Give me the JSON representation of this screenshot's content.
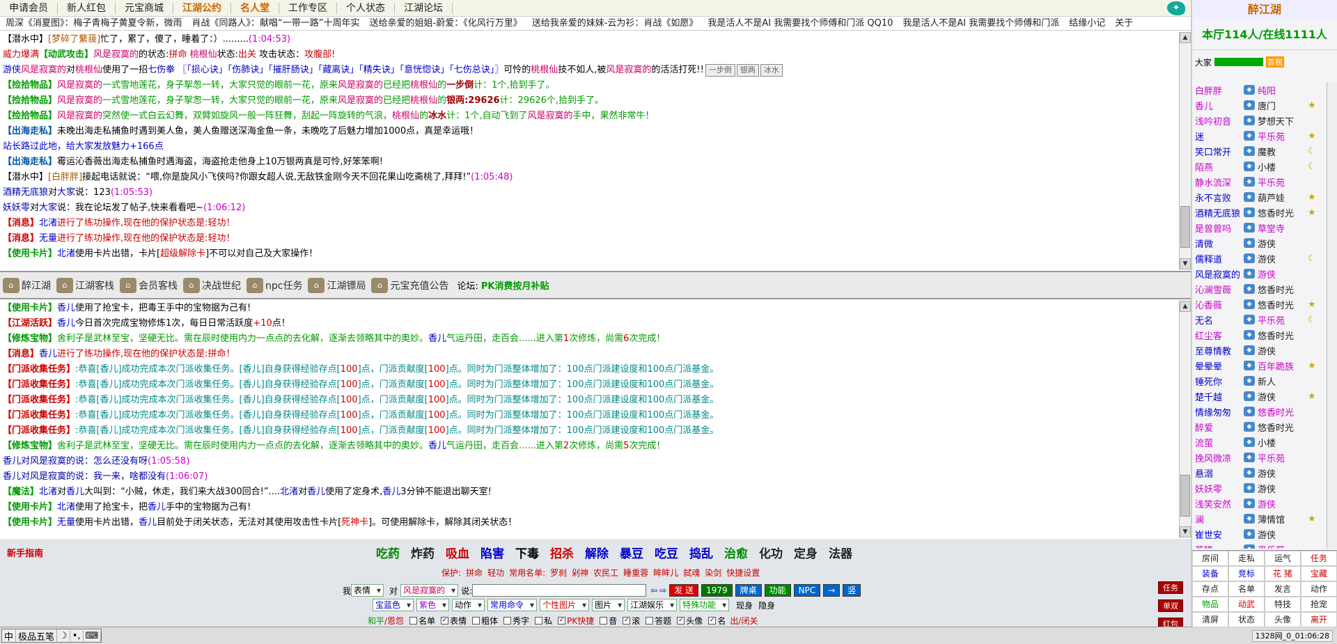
{
  "nav": [
    "申请会员",
    "新人红包",
    "元宝商城",
    "江湖公约",
    "名人堂",
    "工作专区",
    "个人状态",
    "江湖论坛"
  ],
  "marquee": [
    "周深《消夏图》：梅子青梅子黄夏令新，微雨",
    "肖战《同路人》：献唱“一带一路”十周年实",
    "送给亲爱的姐姐-蔚爱：《化风行万里》",
    "送给我亲爱的妹妹-云为衫：肖战《如愿》",
    "我是活人不是AI 我需要找个师傅和门派 QQ10",
    "我是活人不是AI 我需要找个师傅和门派",
    "结缘小记",
    "关于"
  ],
  "chat_top": [
    [
      {
        "t": "【潜水中】",
        "c": "g"
      },
      {
        "t": "[梦碎了蘩菝]",
        "c": "brn"
      },
      {
        "t": "忙了，累了，傻了，睡着了：）.........",
        "c": ""
      },
      {
        "t": "(1:04:53)",
        "c": "mag"
      }
    ],
    [
      {
        "t": "威力爆满",
        "c": "red"
      },
      {
        "t": "【动武攻击】",
        "c": "gtag"
      },
      {
        "t": "风是寂寞的",
        "c": "pink"
      },
      {
        "t": "的状态:",
        "c": ""
      },
      {
        "t": "拼命",
        "c": "red"
      },
      {
        "t": " 桃根仙",
        "c": "pink"
      },
      {
        "t": "状态:",
        "c": ""
      },
      {
        "t": "出关",
        "c": "red"
      },
      {
        "t": " 攻击状态：",
        "c": ""
      },
      {
        "t": "攻腹部!",
        "c": "red"
      }
    ],
    [
      {
        "t": "游侠",
        "c": "blue"
      },
      {
        "t": "风是寂寞的",
        "c": "pink"
      },
      {
        "t": "对",
        "c": ""
      },
      {
        "t": "桃根仙",
        "c": "pink"
      },
      {
        "t": "使用了一招",
        "c": ""
      },
      {
        "t": "七伤拳",
        "c": "nm"
      },
      {
        "t": " 〖「损心诀」「伤肺诀」「摧肝肠诀」「藏离诀」「精失诀」「意恍惚诀」「七伤总诀」〗",
        "c": "blue"
      },
      {
        "t": "可怜的",
        "c": ""
      },
      {
        "t": "桃根仙",
        "c": "pink"
      },
      {
        "t": "技不如人,被",
        "c": ""
      },
      {
        "t": "风是寂寞的",
        "c": "pink"
      },
      {
        "t": "的活活打死!!",
        "c": ""
      }
    ],
    [
      {
        "t": "【捡拾物品】",
        "c": "gtag"
      },
      {
        "t": "风是寂寞的",
        "c": "pink"
      },
      {
        "t": "一式雪地莲花，身子挐怱一转，大家只觉的眼前一花，原来",
        "c": "green"
      },
      {
        "t": "风是寂寞的",
        "c": "pink"
      },
      {
        "t": "已经把",
        "c": "green"
      },
      {
        "t": "桃根仙",
        "c": "pink"
      },
      {
        "t": "的",
        "c": "green"
      },
      {
        "t": "一步倒",
        "c": "dred"
      },
      {
        "t": "计：1个,拾到手了。",
        "c": "green"
      }
    ],
    [
      {
        "t": "【捡拾物品】",
        "c": "gtag"
      },
      {
        "t": "风是寂寞的",
        "c": "pink"
      },
      {
        "t": "一式雪地莲花，身子挐怱一转，大家只觉的眼前一花，原来",
        "c": "green"
      },
      {
        "t": "风是寂寞的",
        "c": "pink"
      },
      {
        "t": "已经把",
        "c": "green"
      },
      {
        "t": "桃根仙",
        "c": "pink"
      },
      {
        "t": "的",
        "c": "green"
      },
      {
        "t": "银两:29626",
        "c": "dred"
      },
      {
        "t": "计：29626个,拾到手了。",
        "c": "green"
      }
    ],
    [
      {
        "t": "【捡拾物品】",
        "c": "gtag"
      },
      {
        "t": "风是寂寞的",
        "c": "pink"
      },
      {
        "t": "突然使一式白云幻舞，双臂如旋风一般一阵狂舞，刮起一阵旋转的气浪，",
        "c": "green"
      },
      {
        "t": "桃根仙",
        "c": "pink"
      },
      {
        "t": "的",
        "c": "green"
      },
      {
        "t": "冰水",
        "c": "dred"
      },
      {
        "t": "计：1个,自动飞到了",
        "c": "green"
      },
      {
        "t": "风是寂寞的",
        "c": "pink"
      },
      {
        "t": "手中，果然非常牛！",
        "c": "green"
      }
    ],
    [
      {
        "t": "【出海走私】",
        "c": "btag"
      },
      {
        "t": "未晚出海走私捕鱼时遇到美人鱼，美人鱼赠送深海金鱼一条，未晚吃了后魅力增加1000点，真是幸运哦！",
        "c": ""
      }
    ],
    [
      {
        "t": "站长路过此地，给大家发放魅力+166点",
        "c": "blue"
      }
    ],
    [
      {
        "t": "【出海走私】",
        "c": "btag"
      },
      {
        "t": "霉运沁香薇出海走私捕鱼时遇海盗，海盗抢走他身上10万银两真是可怜,好笨笨啊!",
        "c": ""
      }
    ],
    [
      {
        "t": "【潜水中】",
        "c": "g"
      },
      {
        "t": "[白胖胖]",
        "c": "brn"
      },
      {
        "t": "接起电话就说：“喂,你是旋风小飞侠吗?你跟女超人说,无敌铁金刚今天不回花果山吃斋桃了,拜拜!”",
        "c": ""
      },
      {
        "t": "(1:05:48)",
        "c": "mag"
      }
    ],
    [
      {
        "t": " 酒精无底狼",
        "c": "nm"
      },
      {
        "t": "对",
        "c": ""
      },
      {
        "t": "大家",
        "c": "nm"
      },
      {
        "t": "说：123",
        "c": ""
      },
      {
        "t": "(1:05:53)",
        "c": "mag"
      }
    ],
    [
      {
        "t": " 妖妖零",
        "c": "nm"
      },
      {
        "t": "对",
        "c": ""
      },
      {
        "t": "大家",
        "c": "nm"
      },
      {
        "t": "说：我在论坛发了帖子,快来看看吧~",
        "c": ""
      },
      {
        "t": "(1:06:12)",
        "c": "mag"
      }
    ],
    [
      {
        "t": "【消息】",
        "c": "tag"
      },
      {
        "t": "北渚",
        "c": "blue"
      },
      {
        "t": "进行了练功操作,现在他的保护状态是:",
        "c": "red"
      },
      {
        "t": "轻功！",
        "c": "red"
      }
    ],
    [
      {
        "t": "【消息】",
        "c": "tag"
      },
      {
        "t": "无量",
        "c": "blue"
      },
      {
        "t": "进行了练功操作,现在他的保护状态是:",
        "c": "red"
      },
      {
        "t": "轻功！",
        "c": "red"
      }
    ],
    [
      {
        "t": "【使用卡片】",
        "c": "gtag"
      },
      {
        "t": "北渚",
        "c": "blue"
      },
      {
        "t": "使用卡片出错，卡片[",
        "c": ""
      },
      {
        "t": "超级解除卡",
        "c": "red"
      },
      {
        "t": "]不可以对自己及大家操作！",
        "c": ""
      }
    ]
  ],
  "mini_buttons": [
    "一步倒",
    "银两",
    "冰水"
  ],
  "tabs": [
    "醉江湖",
    "江湖客栈",
    "会员客栈",
    "决战世纪",
    "npc任务",
    "江湖镖局",
    "元宝充值公告"
  ],
  "forum_label": "论坛:",
  "forum_link": "PK消费按月补贴",
  "chat_bottom": [
    [
      {
        "t": "【使用卡片】",
        "c": "gtag"
      },
      {
        "t": "香儿",
        "c": "blue"
      },
      {
        "t": "使用了抢宝卡，把毒王手中的宝物据为己有!",
        "c": ""
      }
    ],
    [
      {
        "t": "【江湖活跃】",
        "c": "tag"
      },
      {
        "t": "香儿",
        "c": "blue"
      },
      {
        "t": "今日首次完成宝物修炼1次，每日日常活跃度",
        "c": ""
      },
      {
        "t": "+10",
        "c": "red"
      },
      {
        "t": "点！",
        "c": ""
      }
    ],
    [
      {
        "t": "【修炼宝物】",
        "c": "gtag"
      },
      {
        "t": "舍利子是武林至宝，坚硬无比。需在辰时使用内力一点点的去化解，逐渐去领略其中的奥妙。",
        "c": "green"
      },
      {
        "t": "香儿",
        "c": "blue"
      },
      {
        "t": "气运丹田，走百会......进入第",
        "c": "green"
      },
      {
        "t": "1",
        "c": "red"
      },
      {
        "t": "次修炼，尚需",
        "c": "green"
      },
      {
        "t": "6",
        "c": "red"
      },
      {
        "t": "次完成！",
        "c": "green"
      }
    ],
    [
      {
        "t": "【消息】",
        "c": "tag"
      },
      {
        "t": "香儿",
        "c": "blue"
      },
      {
        "t": "进行了练功操作,现在他的保护状态是:",
        "c": "red"
      },
      {
        "t": "拼命！",
        "c": "red"
      }
    ],
    [
      {
        "t": "【门派收集任务】",
        "c": "tag"
      },
      {
        "t": ":恭喜[香儿]成功完成本次门派收集任务。[香儿]自身获得经验存点[",
        "c": "tea"
      },
      {
        "t": "100",
        "c": "red"
      },
      {
        "t": "]点，门派贡献度[",
        "c": "tea"
      },
      {
        "t": "100",
        "c": "red"
      },
      {
        "t": "]点。同时为门派整体增加了：100点门派建设度和100点门派基金。",
        "c": "tea"
      }
    ],
    [
      {
        "t": "【门派收集任务】",
        "c": "tag"
      },
      {
        "t": ":恭喜[香儿]成功完成本次门派收集任务。[香儿]自身获得经验存点[",
        "c": "tea"
      },
      {
        "t": "100",
        "c": "red"
      },
      {
        "t": "]点，门派贡献度[",
        "c": "tea"
      },
      {
        "t": "100",
        "c": "red"
      },
      {
        "t": "]点。同时为门派整体增加了：100点门派建设度和100点门派基金。",
        "c": "tea"
      }
    ],
    [
      {
        "t": "【门派收集任务】",
        "c": "tag"
      },
      {
        "t": ":恭喜[香儿]成功完成本次门派收集任务。[香儿]自身获得经验存点[",
        "c": "tea"
      },
      {
        "t": "100",
        "c": "red"
      },
      {
        "t": "]点，门派贡献度[",
        "c": "tea"
      },
      {
        "t": "100",
        "c": "red"
      },
      {
        "t": "]点。同时为门派整体增加了：100点门派建设度和100点门派基金。",
        "c": "tea"
      }
    ],
    [
      {
        "t": "【门派收集任务】",
        "c": "tag"
      },
      {
        "t": ":恭喜[香儿]成功完成本次门派收集任务。[香儿]自身获得经验存点[",
        "c": "tea"
      },
      {
        "t": "100",
        "c": "red"
      },
      {
        "t": "]点，门派贡献度[",
        "c": "tea"
      },
      {
        "t": "100",
        "c": "red"
      },
      {
        "t": "]点。同时为门派整体增加了：100点门派建设度和100点门派基金。",
        "c": "tea"
      }
    ],
    [
      {
        "t": "【门派收集任务】",
        "c": "tag"
      },
      {
        "t": ":恭喜[香儿]成功完成本次门派收集任务。[香儿]自身获得经验存点[",
        "c": "tea"
      },
      {
        "t": "100",
        "c": "red"
      },
      {
        "t": "]点，门派贡献度[",
        "c": "tea"
      },
      {
        "t": "100",
        "c": "red"
      },
      {
        "t": "]点。同时为门派整体增加了：100点门派建设度和100点门派基金。",
        "c": "tea"
      }
    ],
    [
      {
        "t": "【修炼宝物】",
        "c": "gtag"
      },
      {
        "t": "舍利子是武林至宝，坚硬无比。需在辰时使用内力一点点的去化解，逐渐去领略其中的奥妙。",
        "c": "green"
      },
      {
        "t": "香儿",
        "c": "blue"
      },
      {
        "t": "气运丹田，走百会......进入第",
        "c": "green"
      },
      {
        "t": "2",
        "c": "red"
      },
      {
        "t": "次修炼，尚需",
        "c": "green"
      },
      {
        "t": "5",
        "c": "red"
      },
      {
        "t": "次完成！",
        "c": "green"
      }
    ],
    [
      {
        "t": " 香儿对风是寂寞的说：怎么还没有呀",
        "c": "nm"
      },
      {
        "t": "(1:05:58)",
        "c": "mag"
      }
    ],
    [
      {
        "t": " 香儿对风是寂寞的说：我一来，啥都没有",
        "c": "nm"
      },
      {
        "t": "(1:06:07)",
        "c": "mag"
      }
    ],
    [
      {
        "t": "【魔法】",
        "c": "gtag"
      },
      {
        "t": "北渚",
        "c": "blue"
      },
      {
        "t": "对",
        "c": ""
      },
      {
        "t": "香儿",
        "c": "blue"
      },
      {
        "t": "大叫到：“小贼，休走，我们来大战300回合!”....",
        "c": ""
      },
      {
        "t": "北渚",
        "c": "blue"
      },
      {
        "t": "对",
        "c": ""
      },
      {
        "t": "香儿",
        "c": "blue"
      },
      {
        "t": "使用了定身术,",
        "c": ""
      },
      {
        "t": "香儿",
        "c": "blue"
      },
      {
        "t": "3分钟不能退出聊天室!",
        "c": ""
      }
    ],
    [
      {
        "t": "【使用卡片】",
        "c": "gtag"
      },
      {
        "t": "北渚",
        "c": "blue"
      },
      {
        "t": "使用了抢宝卡，把",
        "c": ""
      },
      {
        "t": "香儿",
        "c": "blue"
      },
      {
        "t": "手中的宝物据为己有!",
        "c": ""
      }
    ],
    [
      {
        "t": "【使用卡片】",
        "c": "gtag"
      },
      {
        "t": "无量",
        "c": "blue"
      },
      {
        "t": "使用卡片出错，",
        "c": ""
      },
      {
        "t": "香儿",
        "c": "blue"
      },
      {
        "t": "目前处于闭关状态，无法对其使用攻击性卡片[",
        "c": ""
      },
      {
        "t": "死神卡",
        "c": "red"
      },
      {
        "t": "]。可使用解除卡，解除其闭关状态！",
        "c": ""
      }
    ]
  ],
  "guide": "新手指南",
  "actions": [
    {
      "l": "吃药",
      "c": "#080"
    },
    {
      "l": "炸药",
      "c": "#222"
    },
    {
      "l": "吸血",
      "c": "#c00"
    },
    {
      "l": "陷害",
      "c": "#00c"
    },
    {
      "l": "下毒",
      "c": "#000"
    },
    {
      "l": "招杀",
      "c": "#c00"
    },
    {
      "l": "解除",
      "c": "#00c"
    },
    {
      "l": "暴豆",
      "c": "#00c"
    },
    {
      "l": "吃豆",
      "c": "#00c"
    },
    {
      "l": "捣乱",
      "c": "#00c"
    },
    {
      "l": "治愈",
      "c": "#080"
    },
    {
      "l": "化功",
      "c": "#222"
    },
    {
      "l": "定身",
      "c": "#222"
    },
    {
      "l": "法器",
      "c": "#222"
    }
  ],
  "quick": {
    "protect_label": "保护:",
    "protect": [
      "拼命",
      "轻功"
    ],
    "names_label": "常用名单:",
    "names": [
      "罗刹",
      "剁神",
      "农民工",
      "睡重蓉",
      "眸眸儿",
      "弑魂",
      "染剑",
      "快捷设置"
    ]
  },
  "input": {
    "me_label": "我",
    "expr": "表情",
    "to_label": "对",
    "target": "风是寂寞的",
    "say_label": "说:",
    "send": "发 送",
    "num": "1979",
    "btns": [
      "牌桌",
      "功能",
      "NPC",
      "→",
      "竖"
    ]
  },
  "row3": {
    "color1": "宝蓝色",
    "color2": "紫色",
    "action": "动作",
    "cmd": "常用命令",
    "pic": "个性图片",
    "img": "图片",
    "ent": "江湖娱乐",
    "spec": "特殊功能",
    "show": "现身",
    "hide": "隐身"
  },
  "row4": {
    "peace": "和平",
    "hate": "/恩怨",
    "checks": [
      {
        "l": "名单",
        "on": false
      },
      {
        "l": "表情",
        "on": true
      },
      {
        "l": "粗体",
        "on": false
      },
      {
        "l": "秀字",
        "on": false
      },
      {
        "l": "私",
        "on": false
      },
      {
        "l": "PK快捷",
        "on": true,
        "red": true
      },
      {
        "l": "音",
        "on": false
      },
      {
        "l": "滚",
        "on": true
      },
      {
        "l": "答题",
        "on": false
      },
      {
        "l": "头像",
        "on": true
      },
      {
        "l": "名",
        "on": true
      }
    ],
    "close": "出/闭关"
  },
  "side_buttons": [
    "任务",
    "单双",
    "红包"
  ],
  "taskbar": {
    "ime": [
      "中",
      "极品五笔",
      "☽",
      "•,",
      "⌨"
    ],
    "clock": "1328网_0_01:06:28"
  },
  "right": {
    "title": "醉江湖",
    "count": "本厅114人/在线1111人",
    "room_label": "大家",
    "room_btn": "首税",
    "users": [
      [
        "白胖胖",
        "纯阳",
        ""
      ],
      [
        "香儿",
        "唐门",
        "★"
      ],
      [
        "浅吟初音",
        "梦想天下",
        ""
      ],
      [
        "迷",
        "平乐苑",
        "★"
      ],
      [
        "笑口常开",
        "魔教",
        "☾"
      ],
      [
        "陌燕",
        "小楼",
        "☾"
      ],
      [
        "静水流深",
        "平乐苑",
        ""
      ],
      [
        "永不言败",
        "葫芦娃",
        "★"
      ],
      [
        "酒精无底狼",
        "悠香时光",
        "★"
      ],
      [
        "是曾曾吗",
        "草堂寺",
        ""
      ],
      [
        "清微",
        "游侠",
        ""
      ],
      [
        "儒释道",
        "游侠",
        "☾"
      ],
      [
        "风是寂寞的",
        "游侠",
        ""
      ],
      [
        "沁澜雪薇",
        "悠香时光",
        ""
      ],
      [
        "沁香薇",
        "悠香时光",
        "★"
      ],
      [
        "无名",
        "平乐苑",
        "☾"
      ],
      [
        "红尘客",
        "悠香时光",
        ""
      ],
      [
        "至尊情教",
        "游侠",
        ""
      ],
      [
        "晕晕晕",
        "百年跪族",
        "★"
      ],
      [
        "锤死你",
        "新人",
        ""
      ],
      [
        "楚千越",
        "游侠",
        "★"
      ],
      [
        "情缘匆匆",
        "悠香时光",
        ""
      ],
      [
        "醉爱",
        "悠香时光",
        ""
      ],
      [
        "流萤",
        "小楼",
        ""
      ],
      [
        "挽风微凉",
        "平乐苑",
        ""
      ],
      [
        "悬溺",
        "游侠",
        ""
      ],
      [
        "妖妖零",
        "游侠",
        ""
      ],
      [
        "浅笑安然",
        "游侠",
        ""
      ],
      [
        "澜",
        "薄情馆",
        "★"
      ],
      [
        "崔世安",
        "游侠",
        ""
      ],
      [
        "若曦",
        "平乐苑",
        ""
      ]
    ],
    "grid": [
      "房间",
      "走私",
      "运气",
      "任务",
      "装备",
      "竞标",
      "花 猪",
      "宝藏",
      "存点",
      "名单",
      "发言",
      "动作",
      "物品",
      "动武",
      "特技",
      "抢宠",
      "清屏",
      "状态",
      "头像",
      "离开"
    ]
  }
}
